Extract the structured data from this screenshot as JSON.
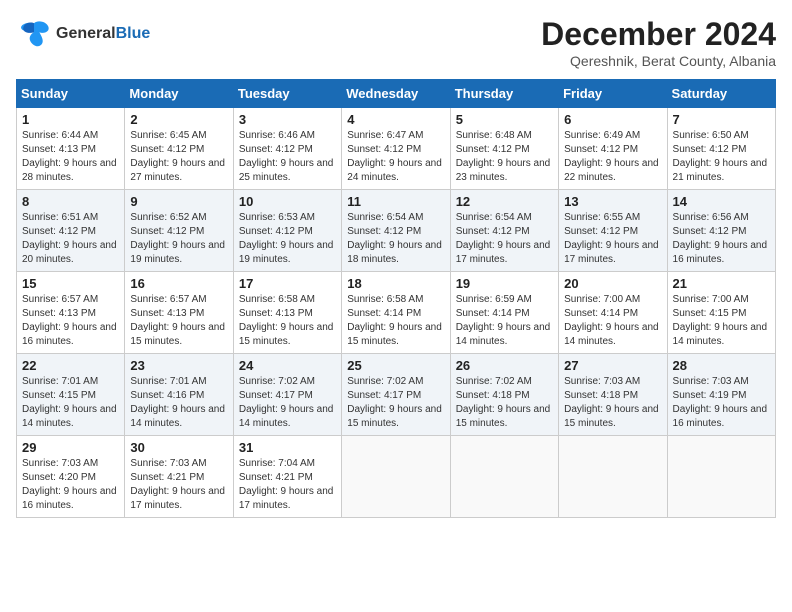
{
  "logo": {
    "line1": "General",
    "line2": "Blue"
  },
  "title": "December 2024",
  "subtitle": "Qereshnik, Berat County, Albania",
  "weekdays": [
    "Sunday",
    "Monday",
    "Tuesday",
    "Wednesday",
    "Thursday",
    "Friday",
    "Saturday"
  ],
  "weeks": [
    [
      {
        "day": "1",
        "sunrise": "Sunrise: 6:44 AM",
        "sunset": "Sunset: 4:13 PM",
        "daylight": "Daylight: 9 hours and 28 minutes."
      },
      {
        "day": "2",
        "sunrise": "Sunrise: 6:45 AM",
        "sunset": "Sunset: 4:12 PM",
        "daylight": "Daylight: 9 hours and 27 minutes."
      },
      {
        "day": "3",
        "sunrise": "Sunrise: 6:46 AM",
        "sunset": "Sunset: 4:12 PM",
        "daylight": "Daylight: 9 hours and 25 minutes."
      },
      {
        "day": "4",
        "sunrise": "Sunrise: 6:47 AM",
        "sunset": "Sunset: 4:12 PM",
        "daylight": "Daylight: 9 hours and 24 minutes."
      },
      {
        "day": "5",
        "sunrise": "Sunrise: 6:48 AM",
        "sunset": "Sunset: 4:12 PM",
        "daylight": "Daylight: 9 hours and 23 minutes."
      },
      {
        "day": "6",
        "sunrise": "Sunrise: 6:49 AM",
        "sunset": "Sunset: 4:12 PM",
        "daylight": "Daylight: 9 hours and 22 minutes."
      },
      {
        "day": "7",
        "sunrise": "Sunrise: 6:50 AM",
        "sunset": "Sunset: 4:12 PM",
        "daylight": "Daylight: 9 hours and 21 minutes."
      }
    ],
    [
      {
        "day": "8",
        "sunrise": "Sunrise: 6:51 AM",
        "sunset": "Sunset: 4:12 PM",
        "daylight": "Daylight: 9 hours and 20 minutes."
      },
      {
        "day": "9",
        "sunrise": "Sunrise: 6:52 AM",
        "sunset": "Sunset: 4:12 PM",
        "daylight": "Daylight: 9 hours and 19 minutes."
      },
      {
        "day": "10",
        "sunrise": "Sunrise: 6:53 AM",
        "sunset": "Sunset: 4:12 PM",
        "daylight": "Daylight: 9 hours and 19 minutes."
      },
      {
        "day": "11",
        "sunrise": "Sunrise: 6:54 AM",
        "sunset": "Sunset: 4:12 PM",
        "daylight": "Daylight: 9 hours and 18 minutes."
      },
      {
        "day": "12",
        "sunrise": "Sunrise: 6:54 AM",
        "sunset": "Sunset: 4:12 PM",
        "daylight": "Daylight: 9 hours and 17 minutes."
      },
      {
        "day": "13",
        "sunrise": "Sunrise: 6:55 AM",
        "sunset": "Sunset: 4:12 PM",
        "daylight": "Daylight: 9 hours and 17 minutes."
      },
      {
        "day": "14",
        "sunrise": "Sunrise: 6:56 AM",
        "sunset": "Sunset: 4:12 PM",
        "daylight": "Daylight: 9 hours and 16 minutes."
      }
    ],
    [
      {
        "day": "15",
        "sunrise": "Sunrise: 6:57 AM",
        "sunset": "Sunset: 4:13 PM",
        "daylight": "Daylight: 9 hours and 16 minutes."
      },
      {
        "day": "16",
        "sunrise": "Sunrise: 6:57 AM",
        "sunset": "Sunset: 4:13 PM",
        "daylight": "Daylight: 9 hours and 15 minutes."
      },
      {
        "day": "17",
        "sunrise": "Sunrise: 6:58 AM",
        "sunset": "Sunset: 4:13 PM",
        "daylight": "Daylight: 9 hours and 15 minutes."
      },
      {
        "day": "18",
        "sunrise": "Sunrise: 6:58 AM",
        "sunset": "Sunset: 4:14 PM",
        "daylight": "Daylight: 9 hours and 15 minutes."
      },
      {
        "day": "19",
        "sunrise": "Sunrise: 6:59 AM",
        "sunset": "Sunset: 4:14 PM",
        "daylight": "Daylight: 9 hours and 14 minutes."
      },
      {
        "day": "20",
        "sunrise": "Sunrise: 7:00 AM",
        "sunset": "Sunset: 4:14 PM",
        "daylight": "Daylight: 9 hours and 14 minutes."
      },
      {
        "day": "21",
        "sunrise": "Sunrise: 7:00 AM",
        "sunset": "Sunset: 4:15 PM",
        "daylight": "Daylight: 9 hours and 14 minutes."
      }
    ],
    [
      {
        "day": "22",
        "sunrise": "Sunrise: 7:01 AM",
        "sunset": "Sunset: 4:15 PM",
        "daylight": "Daylight: 9 hours and 14 minutes."
      },
      {
        "day": "23",
        "sunrise": "Sunrise: 7:01 AM",
        "sunset": "Sunset: 4:16 PM",
        "daylight": "Daylight: 9 hours and 14 minutes."
      },
      {
        "day": "24",
        "sunrise": "Sunrise: 7:02 AM",
        "sunset": "Sunset: 4:17 PM",
        "daylight": "Daylight: 9 hours and 14 minutes."
      },
      {
        "day": "25",
        "sunrise": "Sunrise: 7:02 AM",
        "sunset": "Sunset: 4:17 PM",
        "daylight": "Daylight: 9 hours and 15 minutes."
      },
      {
        "day": "26",
        "sunrise": "Sunrise: 7:02 AM",
        "sunset": "Sunset: 4:18 PM",
        "daylight": "Daylight: 9 hours and 15 minutes."
      },
      {
        "day": "27",
        "sunrise": "Sunrise: 7:03 AM",
        "sunset": "Sunset: 4:18 PM",
        "daylight": "Daylight: 9 hours and 15 minutes."
      },
      {
        "day": "28",
        "sunrise": "Sunrise: 7:03 AM",
        "sunset": "Sunset: 4:19 PM",
        "daylight": "Daylight: 9 hours and 16 minutes."
      }
    ],
    [
      {
        "day": "29",
        "sunrise": "Sunrise: 7:03 AM",
        "sunset": "Sunset: 4:20 PM",
        "daylight": "Daylight: 9 hours and 16 minutes."
      },
      {
        "day": "30",
        "sunrise": "Sunrise: 7:03 AM",
        "sunset": "Sunset: 4:21 PM",
        "daylight": "Daylight: 9 hours and 17 minutes."
      },
      {
        "day": "31",
        "sunrise": "Sunrise: 7:04 AM",
        "sunset": "Sunset: 4:21 PM",
        "daylight": "Daylight: 9 hours and 17 minutes."
      },
      null,
      null,
      null,
      null
    ]
  ]
}
